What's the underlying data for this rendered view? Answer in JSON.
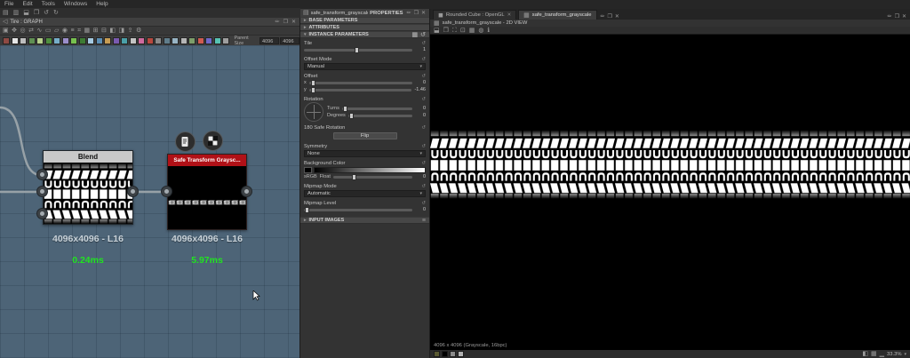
{
  "menu": {
    "items": [
      "File",
      "Edit",
      "Tools",
      "Windows",
      "Help"
    ]
  },
  "quickbar_icons": [
    "new-file",
    "open-file",
    "save",
    "copy",
    "undo",
    "redo"
  ],
  "graph_panel": {
    "tab_title": "Tire : GRAPH",
    "tool_icons": [
      "select",
      "pan",
      "zoom",
      "move",
      "link",
      "frame",
      "comment",
      "pin",
      "align",
      "snap",
      "grid",
      "layout",
      "compact",
      "preview",
      "material",
      "export",
      "settings"
    ],
    "palette_colors": [
      "#8f4a43",
      "#e6e6e6",
      "#bdbdbd",
      "#5f8f52",
      "#b7d08c",
      "#4f8f3e",
      "#76aec9",
      "#9b8eca",
      "#77c14f",
      "#3d7b33",
      "#a5c9e1",
      "#5c8fb5",
      "#c79c53",
      "#7a5ab0",
      "#4aa0a8",
      "#c4c4c4",
      "#d06a9e",
      "#b8483e",
      "#8a8a8a",
      "#607d8b",
      "#98b4c4",
      "#b5b5b5",
      "#7d9e6a",
      "#cf5b50",
      "#6f68c9",
      "#57c2b2",
      "#9e9e9e"
    ],
    "toolbar": {
      "parent_size_label": "Parent Size",
      "width_value": "4096",
      "height_value": "4096"
    },
    "nodes": {
      "blend": {
        "title": "Blend",
        "resolution": "4096x4096 - L16",
        "time": "0.24ms"
      },
      "safe_transform": {
        "title": "Safe Transform Graysc...",
        "resolution": "4096x4096 - L16",
        "time": "5.97ms"
      }
    },
    "colors": {
      "canvas_bg": "#4d6477",
      "node_header_red": "#b01117",
      "blend_header": "#c9c9c9",
      "timing_green": "#21e421",
      "wire": "#97a1a7"
    }
  },
  "properties_panel": {
    "title": "safe_transform_grayscale",
    "suffix": "PROPERTIES",
    "sections": [
      {
        "label": "BASE PARAMETERS"
      },
      {
        "label": "ATTRIBUTES"
      },
      {
        "label": "INSTANCE PARAMETERS"
      }
    ],
    "params": {
      "tile": {
        "label": "Tile",
        "value": "1"
      },
      "offset_mode": {
        "label": "Offset Mode",
        "value": "Manual"
      },
      "offset": {
        "label": "Offset",
        "x_label": "x",
        "x_value": "0",
        "y_label": "y",
        "y_value": "-1.46"
      },
      "rotation": {
        "label": "Rotation",
        "turns_label": "Turns",
        "turns_value": "0",
        "degrees_label": "Degrees",
        "degrees_value": "0"
      },
      "safe_rotation": {
        "label": "180 Safe Rotation",
        "button_label": "Flip"
      },
      "symmetry": {
        "label": "Symmetry",
        "value": "None"
      },
      "background_color": {
        "label": "Background Color",
        "srgb_label": "sRGB",
        "float_label": "Float",
        "value": "0"
      },
      "mipmap_mode": {
        "label": "Mipmap Mode",
        "value": "Automatic"
      },
      "mipmap_level": {
        "label": "Mipmap Level",
        "value": "0"
      }
    },
    "input_images_label": "INPUT IMAGES"
  },
  "view2d_panel": {
    "tabs": [
      {
        "label": "Rounded Cube : OpenGL"
      },
      {
        "label": "safe_transform_grayscale"
      }
    ],
    "title": "safe_transform_grayscale - 2D VIEW",
    "tool_icons": [
      "save-view",
      "copy-view",
      "fit",
      "actual-size",
      "tiling",
      "filter",
      "info"
    ],
    "status": "4096 x 4096 (Grayscale, 16bpc)",
    "channel_swatches": [
      "#5a5a33",
      "#000000",
      "#8a8a8a",
      "#b0b0b0"
    ],
    "bottom_icons": [
      "background-toggle",
      "tiling-toggle",
      "histogram"
    ],
    "zoom": "33.3%"
  }
}
